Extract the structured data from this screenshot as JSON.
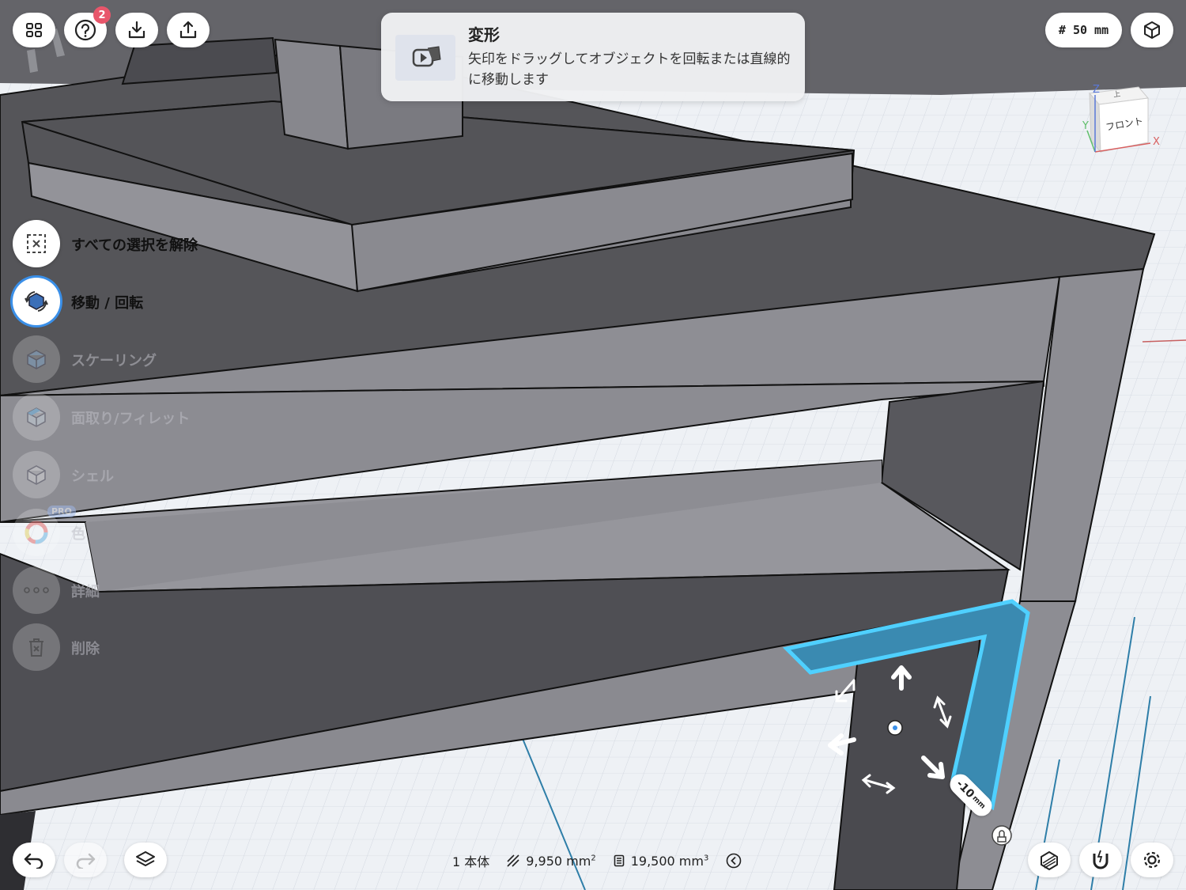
{
  "toolbar": {
    "grid_menu": "grid-icon",
    "help_badge": "2",
    "import": "download-icon",
    "export": "share-icon"
  },
  "tooltip": {
    "title": "変形",
    "body": "矢印をドラッグしてオブジェクトを回転または直線的に移動します"
  },
  "grid_size": "# 50 mm",
  "view_cube": {
    "face": "フロント",
    "top": "上",
    "axis_x": "X",
    "axis_y": "Y",
    "axis_z": "Z"
  },
  "tools": [
    {
      "label": "すべての選択を解除",
      "icon": "deselect-icon",
      "state": "enabled"
    },
    {
      "label": "移動 / 回転",
      "icon": "move-rotate-icon",
      "state": "active"
    },
    {
      "label": "スケーリング",
      "icon": "scale-cube-icon",
      "state": "disabled"
    },
    {
      "label": "面取り/フィレット",
      "icon": "fillet-cube-icon",
      "state": "disabled"
    },
    {
      "label": "シェル",
      "icon": "shell-cube-icon",
      "state": "disabled"
    },
    {
      "label": "色",
      "icon": "color-wheel-icon",
      "state": "disabled",
      "badge": "PRO"
    },
    {
      "label": "詳細",
      "icon": "more-icon",
      "state": "disabled"
    },
    {
      "label": "削除",
      "icon": "trash-icon",
      "state": "disabled"
    }
  ],
  "gizmo": {
    "offset_value": "-10",
    "offset_unit": "mm"
  },
  "status": {
    "bodies": "1 本体",
    "area_value": "9,950 mm",
    "area_exp": "2",
    "volume_value": "19,500 mm",
    "volume_exp": "3"
  },
  "colors": {
    "accent": "#3a8fe8",
    "selection": "#4fc6f5",
    "badge": "#e8566b"
  }
}
